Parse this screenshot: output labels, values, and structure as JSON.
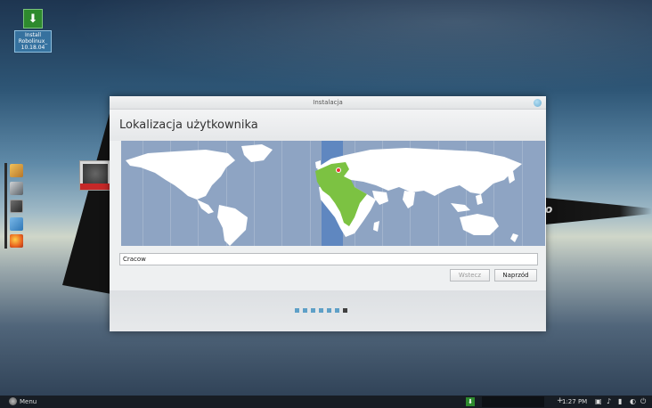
{
  "desktop": {
    "icons": [
      {
        "name": "install-robolinux",
        "label": "Install Robolinux_ 10.18.04",
        "icon": "download-icon"
      }
    ],
    "dock": [
      {
        "icon": "package-icon"
      },
      {
        "icon": "system-settings-icon"
      },
      {
        "icon": "terminal-icon"
      },
      {
        "icon": "folder-icon"
      },
      {
        "icon": "firefox-icon"
      }
    ]
  },
  "window": {
    "title": "Instalacja",
    "heading": "Lokalizacja użytkownika",
    "location": {
      "value": "Cracow"
    },
    "buttons": {
      "back": "Wstecz",
      "next": "Naprzód"
    },
    "progress": {
      "total_steps": 7,
      "current_step": 7
    },
    "colors": {
      "land": "#ffffff",
      "ocean": "#8ea4c3",
      "selected_timezone": "#5f87c0",
      "highlight": "#7cc242"
    }
  },
  "taskbar": {
    "menu_label": "Menu",
    "clock": "1:27 PM",
    "tray": [
      "network-icon",
      "volume-icon",
      "battery-icon",
      "power-icon"
    ]
  }
}
